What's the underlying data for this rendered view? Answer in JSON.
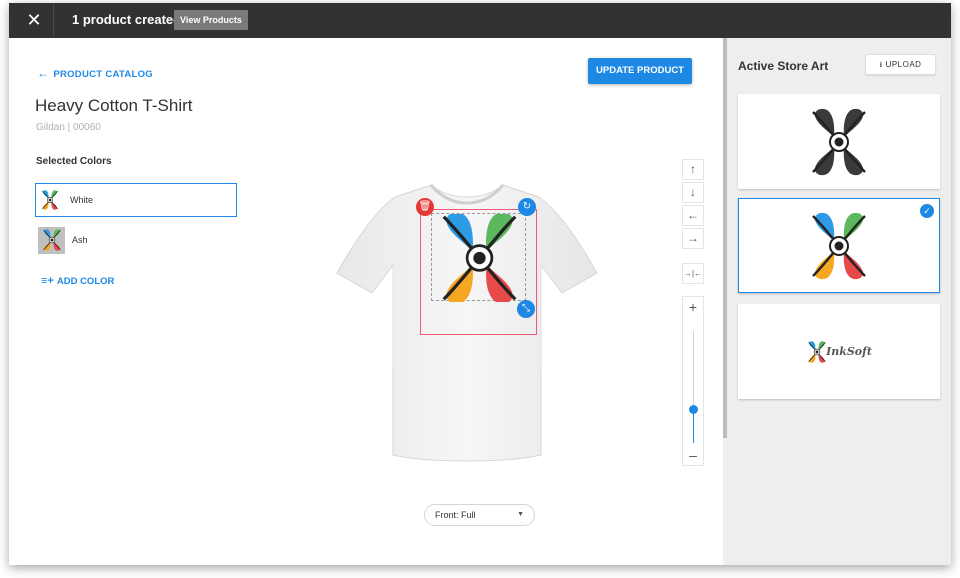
{
  "topbar": {
    "close_icon": "close-icon",
    "message": "1 product created",
    "view_button": "View Products"
  },
  "main": {
    "back_link": "PRODUCT CATALOG",
    "update_button": "UPDATE PRODUCT",
    "product_title": "Heavy Cotton T-Shirt",
    "product_subtitle": "Gildan | 00060",
    "colors_heading": "Selected Colors",
    "colors": [
      {
        "name": "White",
        "selected": true
      },
      {
        "name": "Ash",
        "selected": false
      }
    ],
    "add_color": "ADD COLOR",
    "view_select": {
      "value": "Front: Full"
    },
    "zoom_level_fraction": 0.3
  },
  "toolbar": {
    "up": "↑",
    "down": "↓",
    "left": "←",
    "right": "→",
    "center": "→|←",
    "zoom_in": "+",
    "zoom_out": "–"
  },
  "right_panel": {
    "title": "Active Store Art",
    "upload_button": "UPLOAD",
    "art_items": [
      {
        "style": "black",
        "selected": false
      },
      {
        "style": "color",
        "selected": true
      },
      {
        "style": "wordmark",
        "selected": false,
        "wordmark": "InkSoft"
      }
    ]
  },
  "colors": {
    "accent": "#1e88e5",
    "topbar": "#323232",
    "delete": "#e53935",
    "design_border": "#ef5a7a",
    "logo_blue": "#2e9be6",
    "logo_green": "#5cb85c",
    "logo_orange": "#f5a623",
    "logo_red": "#e84a4a"
  }
}
